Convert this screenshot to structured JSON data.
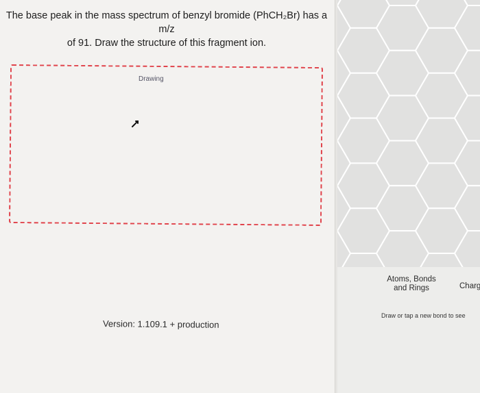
{
  "question": {
    "line1": "The base peak in the mass spectrum of benzyl bromide (PhCH₂Br) has a m/z",
    "line2": "of 91. Draw the structure of this fragment ion."
  },
  "drawing": {
    "label": "Drawing"
  },
  "footer": {
    "version": "Version: 1.109.1 + production"
  },
  "editor": {
    "tabs": [
      {
        "label_line1": "Atoms, Bonds",
        "label_line2": "and Rings"
      },
      {
        "label": "Charg"
      }
    ],
    "hint": "Draw or tap a new bond to see"
  },
  "colors": {
    "drawing_border": "#e0424a",
    "grid_stroke": "#ffffff",
    "grid_fill": "#dcdcdb"
  },
  "icons": {
    "cursor": "pointer-arrow-icon"
  }
}
